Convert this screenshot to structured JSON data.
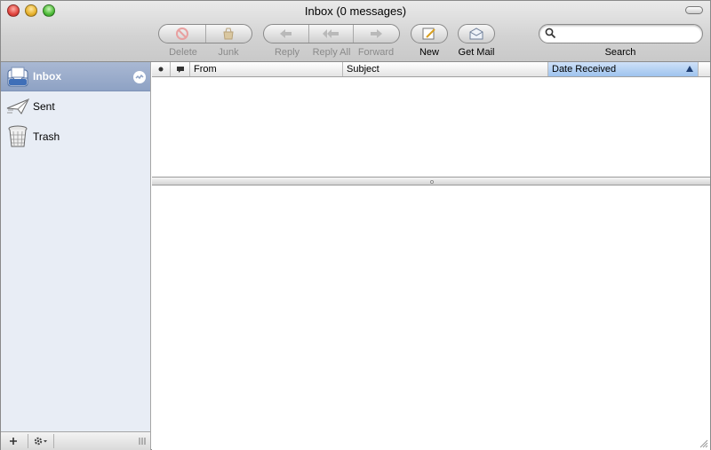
{
  "window": {
    "title": "Inbox (0 messages)"
  },
  "toolbar": {
    "delete_label": "Delete",
    "junk_label": "Junk",
    "reply_label": "Reply",
    "reply_all_label": "Reply All",
    "forward_label": "Forward",
    "new_label": "New",
    "get_mail_label": "Get Mail",
    "search_label": "Search",
    "search_value": ""
  },
  "sidebar": {
    "items": [
      {
        "label": "Inbox",
        "icon": "inbox-icon",
        "selected": true
      },
      {
        "label": "Sent",
        "icon": "sent-icon",
        "selected": false
      },
      {
        "label": "Trash",
        "icon": "trash-icon",
        "selected": false
      }
    ]
  },
  "list": {
    "columns": {
      "from": "From",
      "subject": "Subject",
      "date_received": "Date Received"
    },
    "sort_column": "Date Received",
    "sort_direction": "ascending"
  },
  "colors": {
    "selection": "#8ea2c4",
    "sidebar_bg": "#e8edf5",
    "sorted_column": "#9ec3ee",
    "close": "#e0443e",
    "minimize": "#e6b12c",
    "zoom": "#4dbb38"
  }
}
